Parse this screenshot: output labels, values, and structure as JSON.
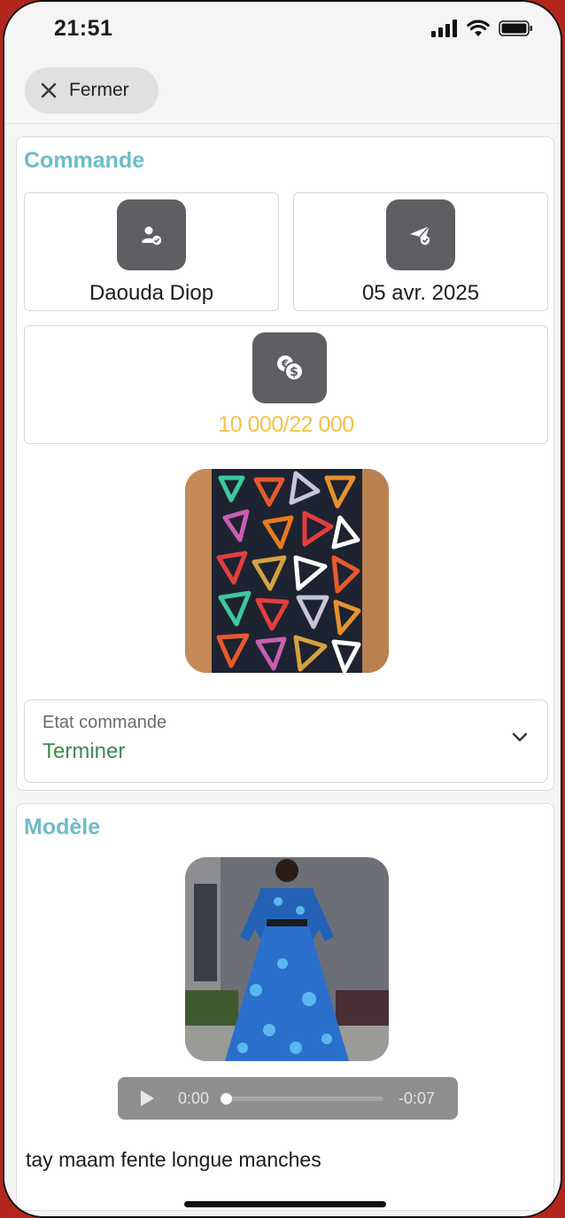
{
  "status_bar": {
    "time": "21:51"
  },
  "header": {
    "close_label": "Fermer"
  },
  "commande": {
    "title": "Commande",
    "client": "Daouda Diop",
    "date": "05 avr. 2025",
    "amount": "10 000/22 000",
    "amount_color": "#f2c34a",
    "state_label": "Etat commande",
    "state_value": "Terminer",
    "state_color": "#3f8a4a"
  },
  "modele": {
    "title": "Modèle",
    "audio": {
      "current": "0:00",
      "remaining": "-0:07",
      "progress": 0
    },
    "description": "tay maam fente longue manches"
  },
  "colors": {
    "accent": "#6cbcc8",
    "tile": "#5e5e63"
  }
}
